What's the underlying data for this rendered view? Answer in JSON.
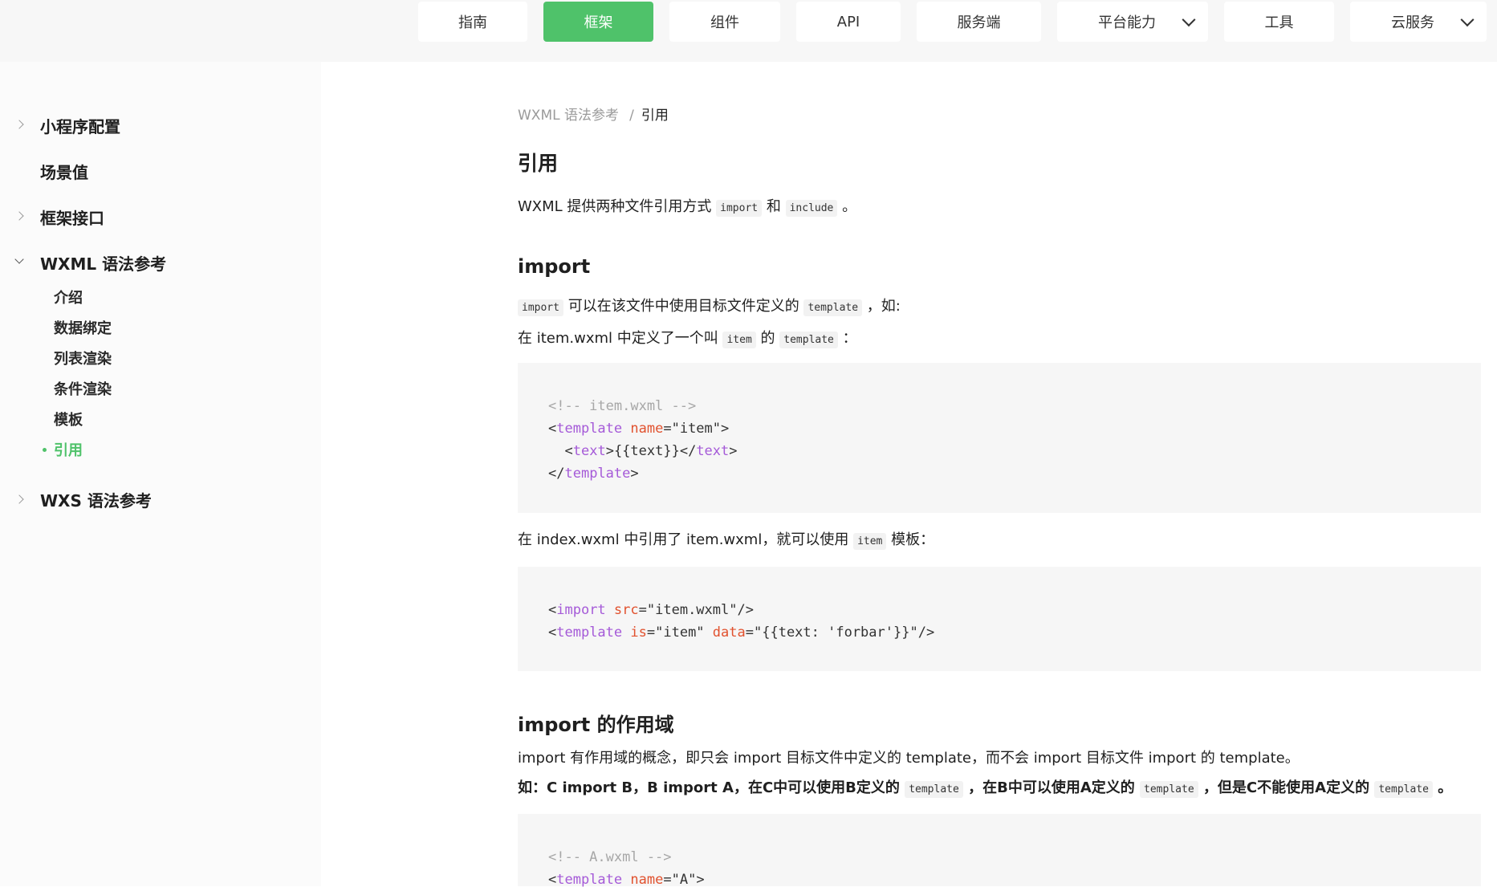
{
  "nav": {
    "tabs": [
      {
        "label": "指南"
      },
      {
        "label": "框架"
      },
      {
        "label": "组件"
      },
      {
        "label": "API"
      },
      {
        "label": "服务端"
      },
      {
        "label": "平台能力"
      },
      {
        "label": "工具"
      },
      {
        "label": "云服务"
      }
    ],
    "active_color": "#4fc26a"
  },
  "sidebar": {
    "items": [
      {
        "label": "小程序配置"
      },
      {
        "label": "场景值"
      },
      {
        "label": "框架接口"
      },
      {
        "label": "WXML 语法参考"
      },
      {
        "label": "WXS 语法参考"
      }
    ],
    "sub_items": [
      {
        "label": "介绍"
      },
      {
        "label": "数据绑定"
      },
      {
        "label": "列表渲染"
      },
      {
        "label": "条件渲染"
      },
      {
        "label": "模板"
      },
      {
        "label": "引用"
      }
    ]
  },
  "breadcrumb": {
    "parent": "WXML 语法参考",
    "separator": "/",
    "current": "引用"
  },
  "page": {
    "title": "引用",
    "intro": {
      "before": "WXML 提供两种文件引用方式",
      "code1": "import",
      "mid": "和",
      "code2": "include",
      "end": "。"
    },
    "import_section": {
      "title": "import",
      "p1": {
        "code": "import",
        "text": "可以在该文件中使用目标文件定义的",
        "code2": "template",
        "end": "，如:"
      },
      "p2": {
        "text": "在 item.wxml 中定义了一个叫",
        "code": "item",
        "mid": "的",
        "code2": "template",
        "end": "："
      },
      "p3": {
        "text": "在 index.wxml 中引用了 item.wxml，就可以使用",
        "code": "item",
        "end": "模板："
      }
    },
    "scope_section": {
      "title": "import 的作用域",
      "p1": "import 有作用域的概念，即只会 import 目标文件中定义的 template，而不会 import 目标文件 import 的 template。",
      "p2": {
        "a": "如：C import B，B import A，在C中可以使用B定义的",
        "code1": "template",
        "b": "，在B中可以使用A定义的",
        "code2": "template",
        "c": "，但是C不能使用A定义的",
        "code3": "template",
        "d": "。"
      }
    }
  },
  "code_blocks": {
    "item": [
      {
        "comment": "<!-- item.wxml -->"
      },
      {
        "lt": "<",
        "tag": "template",
        "sp": " ",
        "attr": "name",
        "eq": "=",
        "val": "\"item\"",
        "gt": ">"
      },
      {
        "indent": "  ",
        "lt": "<",
        "tag": "text",
        "gt": ">",
        "body": "{{text}}",
        "lt2": "</",
        "tag2": "text",
        "gt2": ">"
      },
      {
        "lt": "</",
        "tag": "template",
        "gt": ">"
      }
    ],
    "index": [
      {
        "lt": "<",
        "tag": "import",
        "sp": " ",
        "attr": "src",
        "eq": "=",
        "val": "\"item.wxml\"",
        "gt": "/>"
      },
      {
        "lt": "<",
        "tag": "template",
        "sp": " ",
        "attr": "is",
        "eq": "=",
        "val": "\"item\"",
        "sp2": " ",
        "attr2": "data",
        "eq2": "=",
        "val2": "\"{{text: 'forbar'}}\"",
        "gt": "/>"
      }
    ],
    "a": [
      {
        "comment": "<!-- A.wxml -->"
      },
      {
        "lt": "<",
        "tag": "template",
        "sp": " ",
        "attr": "name",
        "eq": "=",
        "val": "\"A\"",
        "gt": ">"
      }
    ]
  }
}
